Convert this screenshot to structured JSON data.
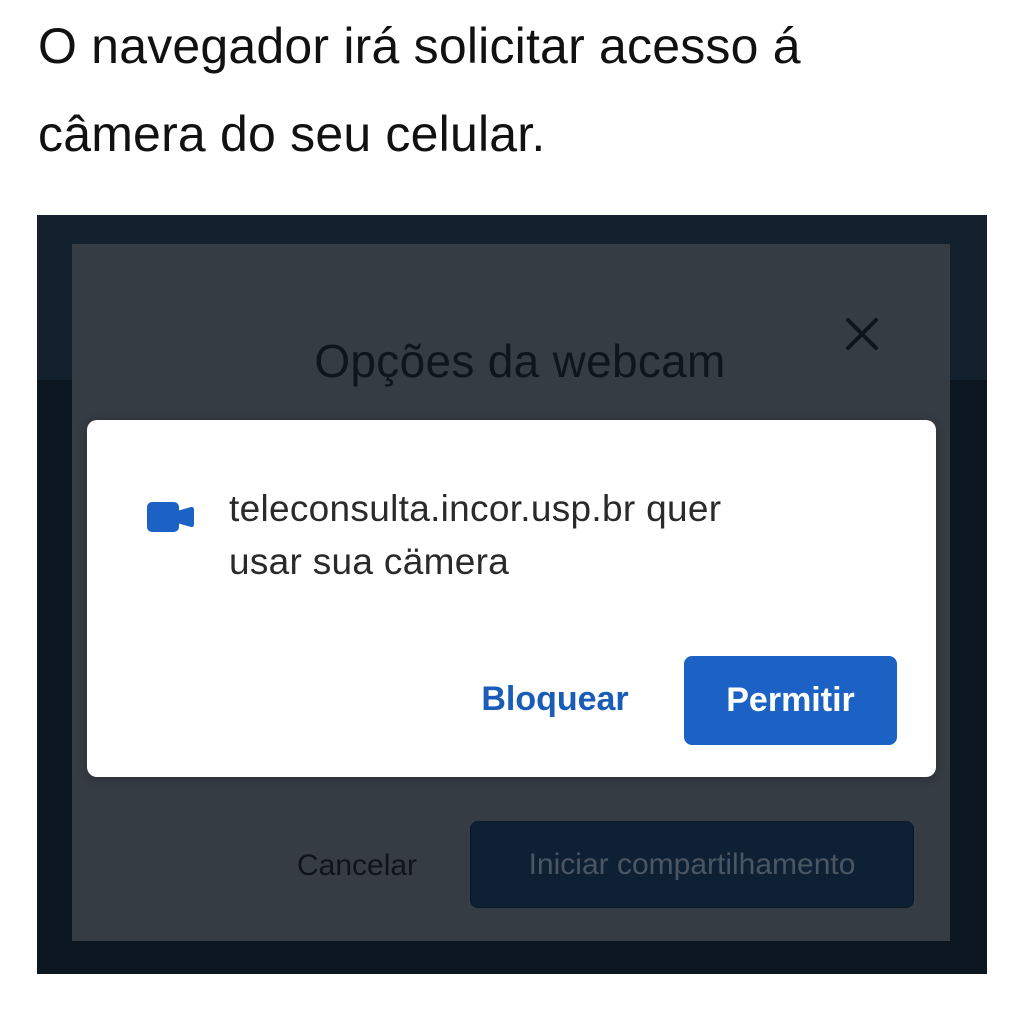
{
  "instruction": {
    "line1": "O navegador irá solicitar acesso á",
    "line2": "câmera do seu celular."
  },
  "webcam_modal": {
    "title": "Opções da webcam",
    "close_icon": "close-icon",
    "cancel_label": "Cancelar",
    "start_share_label": "Iniciar compartilhamento"
  },
  "permission_prompt": {
    "icon": "camera-icon",
    "message_line1": "teleconsulta.incor.usp.br quer",
    "message_line2": "usar sua cämera",
    "block_label": "Bloquear",
    "allow_label": "Permitir"
  },
  "colors": {
    "accent": "#1b62c4",
    "link": "#1a5cb8",
    "backdrop": "#0b1621",
    "modal": "#363c44",
    "dialog": "#ffffff"
  }
}
